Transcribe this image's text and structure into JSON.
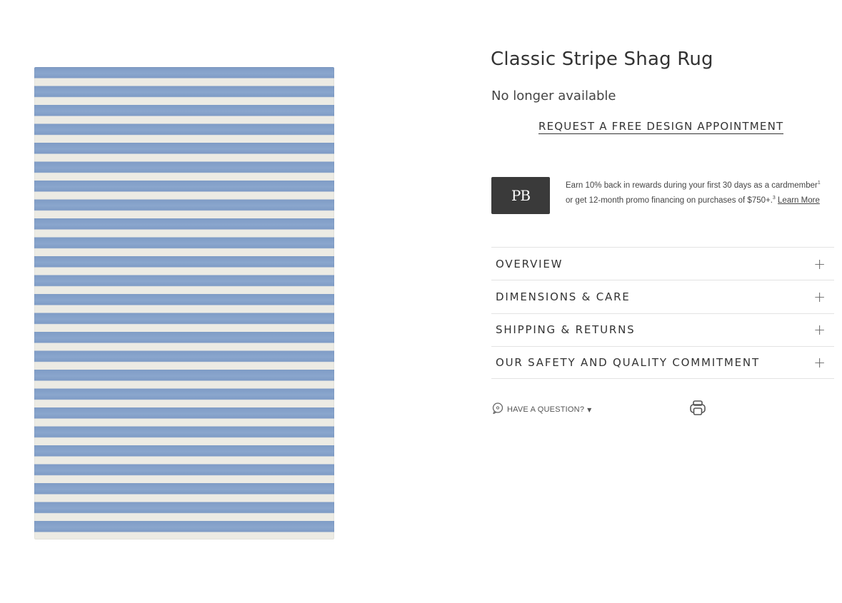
{
  "product": {
    "title": "Classic Stripe Shag Rug",
    "availability": "No longer available",
    "appointment_link": "REQUEST A FREE DESIGN APPOINTMENT",
    "image_alt": "Classic Stripe Shag Rug"
  },
  "promo": {
    "logo_text": "PB",
    "text_part1": "Earn 10% back in rewards during your first 30 days as a cardmember",
    "sup1": "1",
    "text_part2": " or get 12-month promo financing on purchases of $750+.",
    "sup2": "3",
    "learn_more": "Learn More"
  },
  "accordion": [
    {
      "label": "OVERVIEW",
      "icon": "plus-icon"
    },
    {
      "label": "DIMENSIONS & CARE",
      "icon": "plus-icon"
    },
    {
      "label": "SHIPPING & RETURNS",
      "icon": "plus-icon"
    },
    {
      "label": "OUR SAFETY AND QUALITY COMMITMENT",
      "icon": "plus-icon"
    }
  ],
  "actions": {
    "question_label": "HAVE A QUESTION?",
    "question_icon": "chat-bubble-icon",
    "print_icon": "print-icon"
  },
  "colors": {
    "stripe_blue": "#7f9cc6",
    "stripe_cream": "#ecebe4",
    "logo_bg": "#3a3a3a"
  }
}
